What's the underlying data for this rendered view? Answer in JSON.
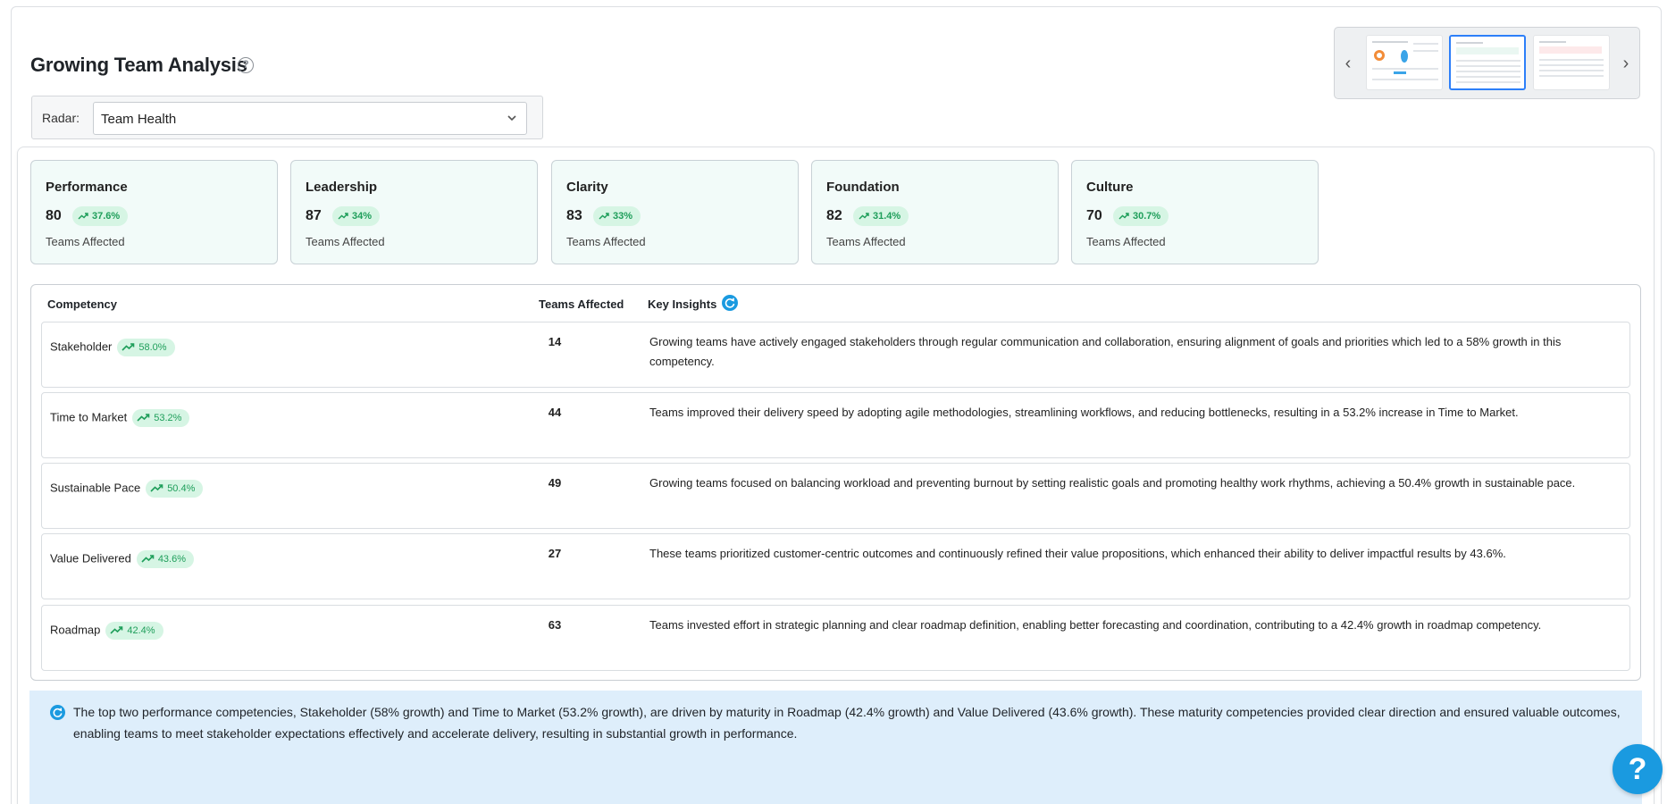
{
  "header": {
    "title": "Growing Team Analysis",
    "help_icon": "question-circle-icon"
  },
  "radar": {
    "label": "Radar:",
    "selected": "Team Health"
  },
  "thumbnails": {
    "count": 3,
    "active_index": 1
  },
  "metrics": [
    {
      "name": "Performance",
      "value": "80",
      "change": "37.6%",
      "sub": "Teams Affected"
    },
    {
      "name": "Leadership",
      "value": "87",
      "change": "34%",
      "sub": "Teams Affected"
    },
    {
      "name": "Clarity",
      "value": "83",
      "change": "33%",
      "sub": "Teams Affected"
    },
    {
      "name": "Foundation",
      "value": "82",
      "change": "31.4%",
      "sub": "Teams Affected"
    },
    {
      "name": "Culture",
      "value": "70",
      "change": "30.7%",
      "sub": "Teams Affected"
    }
  ],
  "table": {
    "headers": {
      "competency": "Competency",
      "teams_affected": "Teams Affected",
      "key_insights": "Key Insights"
    },
    "rows": [
      {
        "competency": "Stakeholder",
        "change": "58.0%",
        "teams": "14",
        "insight": "Growing teams have actively engaged stakeholders through regular communication and collaboration, ensuring alignment of goals and priorities which led to a 58% growth in this competency."
      },
      {
        "competency": "Time to Market",
        "change": "53.2%",
        "teams": "44",
        "insight": "Teams improved their delivery speed by adopting agile methodologies, streamlining workflows, and reducing bottlenecks, resulting in a 53.2% increase in Time to Market."
      },
      {
        "competency": "Sustainable Pace",
        "change": "50.4%",
        "teams": "49",
        "insight": "Growing teams focused on balancing workload and preventing burnout by setting realistic goals and promoting healthy work rhythms, achieving a 50.4% growth in sustainable pace."
      },
      {
        "competency": "Value Delivered",
        "change": "43.6%",
        "teams": "27",
        "insight": "These teams prioritized customer-centric outcomes and continuously refined their value propositions, which enhanced their ability to deliver impactful results by 43.6%."
      },
      {
        "competency": "Roadmap",
        "change": "42.4%",
        "teams": "63",
        "insight": "Teams invested effort in strategic planning and clear roadmap definition, enabling better forecasting and coordination, contributing to a 42.4% growth in roadmap competency."
      }
    ]
  },
  "summary": {
    "text": "The top two performance competencies, Stakeholder (58% growth) and Time to Market (53.2% growth), are driven by maturity in Roadmap (42.4% growth) and Value Delivered (43.6% growth). These maturity competencies provided clear direction and ensured valuable outcomes, enabling teams to meet stakeholder expectations effectively and accelerate delivery, resulting in substantial growth in performance."
  },
  "fab": {
    "label": "?"
  },
  "colors": {
    "accent": "#1a9ae0",
    "positive": "#1e9e5a",
    "positive_bg": "#d6f5e4",
    "card_bg": "#f2fbf9",
    "summary_bg": "#deeefb"
  }
}
